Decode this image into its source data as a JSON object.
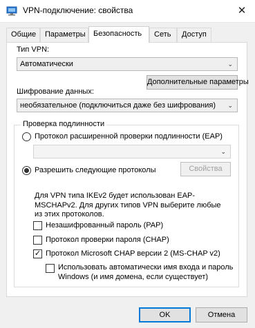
{
  "window": {
    "title": "VPN-подключение: свойства",
    "close_glyph": "✕"
  },
  "tabs": [
    {
      "label": "Общие",
      "active": false
    },
    {
      "label": "Параметры",
      "active": false
    },
    {
      "label": "Безопасность",
      "active": true
    },
    {
      "label": "Сеть",
      "active": false
    },
    {
      "label": "Доступ",
      "active": false
    }
  ],
  "vpn_type": {
    "label": "Тип VPN:",
    "value": "Автоматически",
    "advanced_button": "Дополнительные параметры"
  },
  "encryption": {
    "label": "Шифрование данных:",
    "value": "необязательное (подключиться даже без шифрования)"
  },
  "auth": {
    "group_title": "Проверка подлинности",
    "eap_radio": {
      "label": "Протокол расширенной проверки подлинности (EAP)",
      "selected": false
    },
    "eap_combo_value": "",
    "protocols_radio": {
      "label": "Разрешить следующие протоколы",
      "selected": true
    },
    "properties_button": "Свойства",
    "info_text": "Для VPN типа IKEv2 будет использован EAP-MSCHAPv2. Для других типов VPN выберите любые из этих протоколов.",
    "checkboxes": [
      {
        "label": "Незашифрованный пароль (PAP)",
        "checked": false
      },
      {
        "label": "Протокол проверки пароля (CHAP)",
        "checked": false
      },
      {
        "label": "Протокол Microsoft CHAP версии 2 (MS-CHAP v2)",
        "checked": true
      }
    ],
    "windows_logon": {
      "label": "Использовать автоматически имя входа и пароль Windows (и имя домена, если существует)",
      "checked": false
    }
  },
  "footer": {
    "ok_label": "OK",
    "cancel_label": "Отмена"
  },
  "icons": {
    "arrow": "⌄",
    "check": "✓"
  }
}
